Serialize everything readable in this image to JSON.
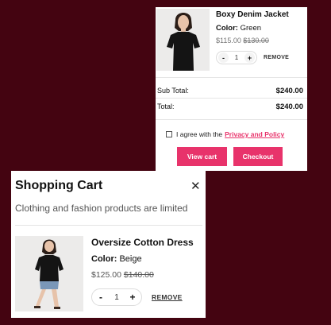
{
  "mini_cart": {
    "item": {
      "name": "Boxy Denim Jacket",
      "color_label": "Color:",
      "color_value": "Green",
      "price": "$115.00",
      "old_price": "$130.00",
      "quantity": "1",
      "minus": "-",
      "plus": "+",
      "remove": "REMOVE"
    },
    "subtotal_label": "Sub Total:",
    "subtotal_value": "$240.00",
    "total_label": "Total:",
    "total_value": "$240.00",
    "agree_text": "I agree with the",
    "agree_link": "Privacy and Policy",
    "view_cart": "View cart",
    "checkout": "Checkout"
  },
  "shopping_cart": {
    "title": "Shopping Cart",
    "close": "✕",
    "subtitle": "Clothing and fashion products are limited",
    "item": {
      "name": "Oversize Cotton Dress",
      "color_label": "Color:",
      "color_value": "Beige",
      "price": "$125.00",
      "old_price": "$140.00",
      "quantity": "1",
      "minus": "-",
      "plus": "+",
      "remove": "REMOVE"
    }
  },
  "colors": {
    "background": "#440411",
    "accent": "#e8336b"
  },
  "icons": {
    "close": "close-icon",
    "checkbox": "checkbox-icon"
  }
}
